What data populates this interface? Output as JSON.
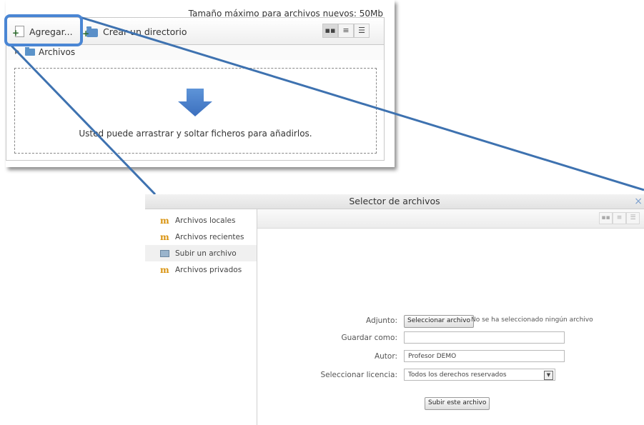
{
  "file_manager": {
    "max_size_text": "Tamaño máximo para archivos nuevos: 50Mb",
    "toolbar": {
      "add_label": "Agregar...",
      "create_dir_label": "Crear un directorio",
      "views": [
        "icon-view-icon",
        "list-view-icon",
        "tree-view-icon"
      ]
    },
    "path": {
      "folder": "Archivos"
    },
    "dropzone": {
      "message": "Usted puede arrastrar y soltar ficheros para añadirlos."
    }
  },
  "file_picker": {
    "title": "Selector de archivos",
    "close": "×",
    "sidebar": [
      {
        "label": "Archivos locales",
        "icon": "moodle-icon",
        "selected": false
      },
      {
        "label": "Archivos recientes",
        "icon": "moodle-icon",
        "selected": false
      },
      {
        "label": "Subir un archivo",
        "icon": "upload-icon",
        "selected": true
      },
      {
        "label": "Archivos privados",
        "icon": "moodle-icon",
        "selected": false
      }
    ],
    "form": {
      "attachment_label": "Adjunto:",
      "select_file_button": "Seleccionar archivo",
      "no_file_text": "No se ha seleccionado ningún archivo",
      "save_as_label": "Guardar como:",
      "save_as_value": "",
      "author_label": "Autor:",
      "author_value": "Profesor DEMO",
      "license_label": "Seleccionar licencia:",
      "license_value": "Todos los derechos reservados",
      "upload_button": "Subir este archivo"
    }
  },
  "colors": {
    "callout_blue": "#3e72b0",
    "folder_blue": "#5b93c9",
    "arrow_blue": "#4a7fcb"
  }
}
